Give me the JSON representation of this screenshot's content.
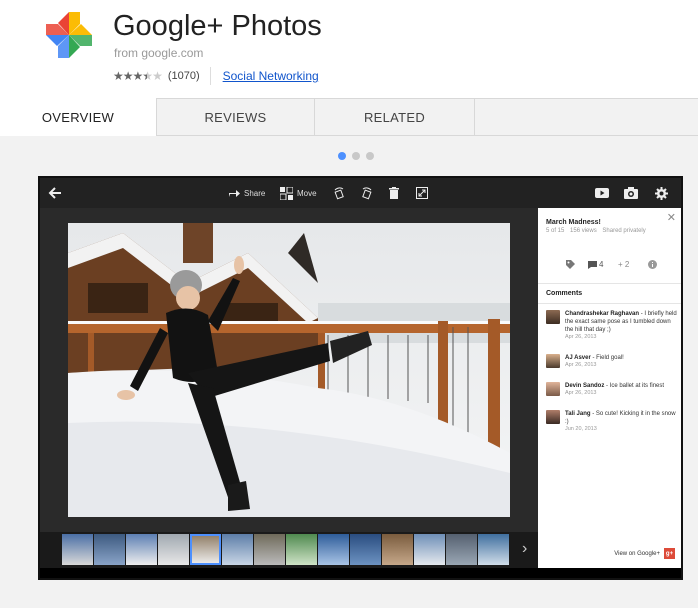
{
  "app": {
    "title": "Google+ Photos",
    "from": "from google.com",
    "rating_count": "(1070)",
    "category": "Social Networking",
    "rating": 3.5,
    "max_rating": 5
  },
  "tabs": [
    {
      "label": "OVERVIEW"
    },
    {
      "label": "REVIEWS"
    },
    {
      "label": "RELATED"
    }
  ],
  "carousel": {
    "slides": 3,
    "active": 1
  },
  "toolbar": {
    "share_label": "Share",
    "move_label": "Move"
  },
  "panel": {
    "album_title": "March Madness!",
    "position": "5 of 15",
    "views": "156 views",
    "sharing": "Shared privately",
    "comment_count": "4",
    "plus_count": "+ 2",
    "comments_heading": "Comments",
    "comments": [
      {
        "author": "Chandrashekar Raghavan",
        "text": " - I briefly held the exact same pose as I tumbled down the hill that day ;)",
        "date": "Apr 26, 2013"
      },
      {
        "author": "AJ Asver",
        "text": " - Field goal!",
        "date": "Apr 26, 2013"
      },
      {
        "author": "Devin Sandoz",
        "text": " - Ice ballet at its finest",
        "date": "Apr 26, 2013"
      },
      {
        "author": "Tali Jang",
        "text": " - So cute! Kicking it in the snow :)",
        "date": "Jun 20, 2013"
      }
    ],
    "view_on": "View on Google+",
    "gplus_badge": "g+"
  },
  "colors": {
    "accent": "#4d90fe",
    "link": "#1155cc",
    "gplus_red": "#dd4b39"
  }
}
